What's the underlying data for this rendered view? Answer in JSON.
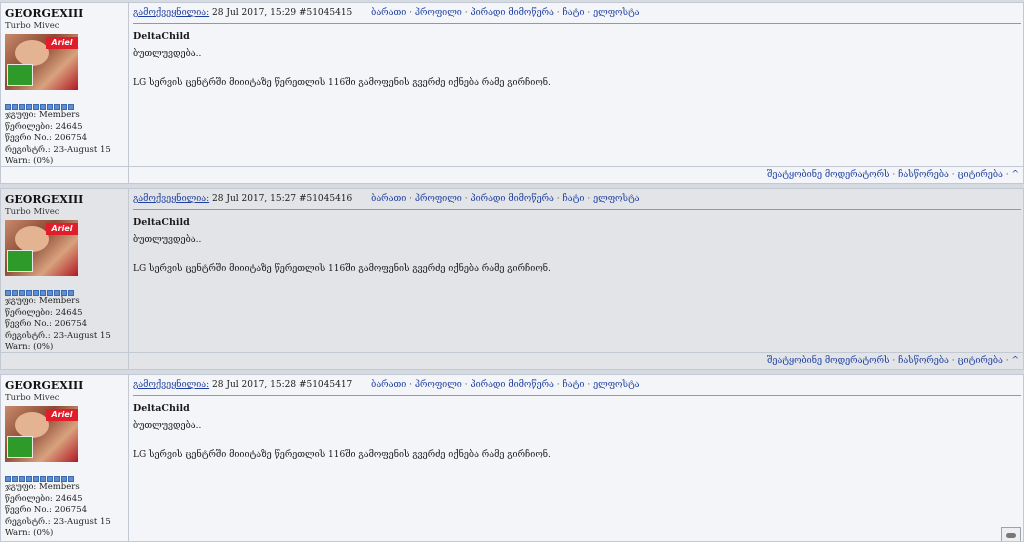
{
  "posts": [
    {
      "author": "GEORGEXIII",
      "user_title": "Turbo Mivec",
      "avatar_banner": "Ariel",
      "group": "ჯგუფი: Members",
      "posts_count": "წერილები: 24645",
      "member_no": "წევრი No.: 206754",
      "registered": "რეგისტრ.: 23-August 15",
      "warn": "Warn: (0%)",
      "posted_label": "გამოქვეყნილია:",
      "datetime": "28 Jul 2017, 15:29",
      "post_id": "#51045415",
      "quote_author": "DeltaChild",
      "line1": "ბუთლუვდება..",
      "line2": "LG სერვის ცენტრში მიიიტაზე წერეთლის 116ში გამოფენის გვერძე იქნება რამე გირჩიონ."
    },
    {
      "author": "GEORGEXIII",
      "user_title": "Turbo Mivec",
      "avatar_banner": "Ariel",
      "group": "ჯგუფი: Members",
      "posts_count": "წერილები: 24645",
      "member_no": "წევრი No.: 206754",
      "registered": "რეგისტრ.: 23-August 15",
      "warn": "Warn: (0%)",
      "posted_label": "გამოქვეყნილია:",
      "datetime": "28 Jul 2017, 15:27",
      "post_id": "#51045416",
      "quote_author": "DeltaChild",
      "line1": "ბუთლუვდება..",
      "line2": "LG სერვის ცენტრში მიიიტაზე წერეთლის 116ში გამოფენის გვერძე იქნება რამე გირჩიონ."
    },
    {
      "author": "GEORGEXIII",
      "user_title": "Turbo Mivec",
      "avatar_banner": "Ariel",
      "group": "ჯგუფი: Members",
      "posts_count": "წერილები: 24645",
      "member_no": "წევრი No.: 206754",
      "registered": "რეგისტრ.: 23-August 15",
      "warn": "Warn: (0%)",
      "posted_label": "გამოქვეყნილია:",
      "datetime": "28 Jul 2017, 15:28",
      "post_id": "#51045417",
      "quote_author": "DeltaChild",
      "line1": "ბუთლუვდება..",
      "line2": "LG სერვის ცენტრში მიიიტაზე წერეთლის 116ში გამოფენის გვერძე იქნება რამე გირჩიონ."
    }
  ],
  "nav": {
    "card": "ბარათი",
    "profile": "პროფილი",
    "pm": "პირადი მიმოწერა",
    "chat": "ჩატი",
    "email": "ელფოსტა",
    "sep": "·"
  },
  "footer": {
    "report": "შეატყობინე მოდერატორს",
    "edit": "ჩასწორება",
    "quote": "ციტირება",
    "top": "^",
    "sep": "·"
  },
  "colors": {
    "link": "#1f3fa0",
    "light_bg": "#f3f5f8",
    "dark_bg": "#e2e4e7",
    "border": "#c3c9d3",
    "rank_pip": "#5e8fd1"
  }
}
